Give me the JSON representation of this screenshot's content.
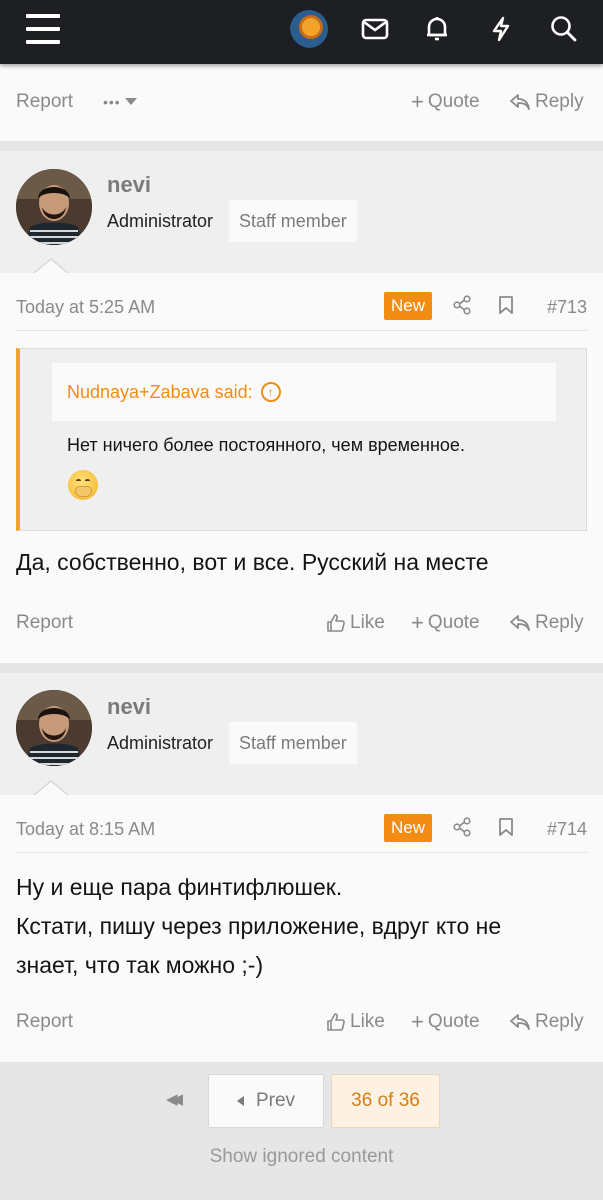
{
  "topbar": {
    "icons": [
      "menu-icon",
      "site-logo",
      "inbox-icon",
      "bell-icon",
      "bolt-icon",
      "search-icon"
    ]
  },
  "prev_post_actions": {
    "report": "Report",
    "more": "•••",
    "quote": "Quote",
    "reply": "Reply"
  },
  "posts": [
    {
      "username": "nevi",
      "user_title": "Administrator",
      "staff_badge": "Staff member",
      "date": "Today at 5:25 AM",
      "new_badge": "New",
      "post_number": "#713",
      "quote": {
        "author": "Nudnaya+Zabava said:",
        "text": "Нет ничего более постоянного, чем временное."
      },
      "body": [
        "Да, собственно, вот и все. Русский на месте"
      ],
      "actions": {
        "report": "Report",
        "like": "Like",
        "quote": "Quote",
        "reply": "Reply"
      }
    },
    {
      "username": "nevi",
      "user_title": "Administrator",
      "staff_badge": "Staff member",
      "date": "Today at 8:15 AM",
      "new_badge": "New",
      "post_number": "#714",
      "body": [
        "Ну и еще пара финтифлюшек.",
        "Кстати, пишу через приложение, вдруг кто не",
        "знает, что так можно ;-)"
      ],
      "actions": {
        "report": "Report",
        "like": "Like",
        "quote": "Quote",
        "reply": "Reply"
      }
    }
  ],
  "pagination": {
    "prev_label": "Prev",
    "current": "36 of 36",
    "show_ignored": "Show ignored content"
  },
  "colors": {
    "accent": "#f28c12",
    "topbar": "#1d1f22",
    "muted_text": "#8a8a8a"
  }
}
